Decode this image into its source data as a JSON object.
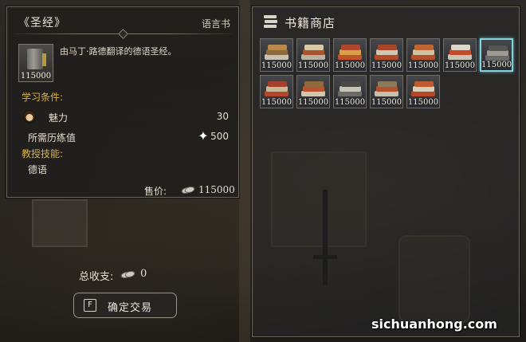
{
  "info_panel": {
    "title": "《圣经》",
    "category": "语言书",
    "thumb_price": "115000",
    "description": "由马丁·路德翻译的德语圣经。",
    "requirements_label": "学习条件:",
    "requirements": [
      {
        "label": "魅力",
        "value": "30",
        "icon": "charm-icon"
      },
      {
        "label": "所需历练值",
        "value": "500",
        "icon": "spark-icon"
      }
    ],
    "skills_label": "教授技能:",
    "skill": "德语",
    "price_label": "售价:",
    "price_value": "115000"
  },
  "shop": {
    "title": "书籍商店",
    "items": [
      {
        "price": "115000",
        "colors": [
          "#c7c2b4",
          "#8c6a3e",
          "#b98a4a"
        ],
        "selected": false
      },
      {
        "price": "115000",
        "colors": [
          "#b8b2a4",
          "#a8542e",
          "#d8c9a6"
        ],
        "selected": false
      },
      {
        "price": "115000",
        "colors": [
          "#c0522b",
          "#d9a04a",
          "#b0462a"
        ],
        "selected": false
      },
      {
        "price": "115000",
        "colors": [
          "#b24a2a",
          "#cfc7b2",
          "#a8442a"
        ],
        "selected": false
      },
      {
        "price": "115000",
        "colors": [
          "#b4502c",
          "#d2c3a2",
          "#c06434"
        ],
        "selected": false
      },
      {
        "price": "115000",
        "colors": [
          "#c9c4b8",
          "#c44a2c",
          "#dcd6c8"
        ],
        "selected": false
      },
      {
        "price": "115000",
        "colors": [
          "#6a6a68",
          "#9c9a92",
          "#57554f"
        ],
        "selected": true
      },
      {
        "price": "115000",
        "colors": [
          "#b3462b",
          "#c9b89a",
          "#a5402a"
        ],
        "selected": false
      },
      {
        "price": "115000",
        "colors": [
          "#cfc6b2",
          "#b9522e",
          "#8e6a3e"
        ],
        "selected": false
      },
      {
        "price": "115000",
        "colors": [
          "#6b6a66",
          "#c9c4b8",
          "#4a4a48"
        ],
        "selected": false
      },
      {
        "price": "115000",
        "colors": [
          "#c6bfae",
          "#b4502c",
          "#8a7a5a"
        ],
        "selected": false
      },
      {
        "price": "115000",
        "colors": [
          "#b6462a",
          "#d6ceb8",
          "#c05a30"
        ],
        "selected": false
      }
    ]
  },
  "footer": {
    "total_label": "总收支:",
    "total_value": "0",
    "confirm_key": "F",
    "confirm_label": "确定交易"
  },
  "watermark": "sichuanhong.com"
}
